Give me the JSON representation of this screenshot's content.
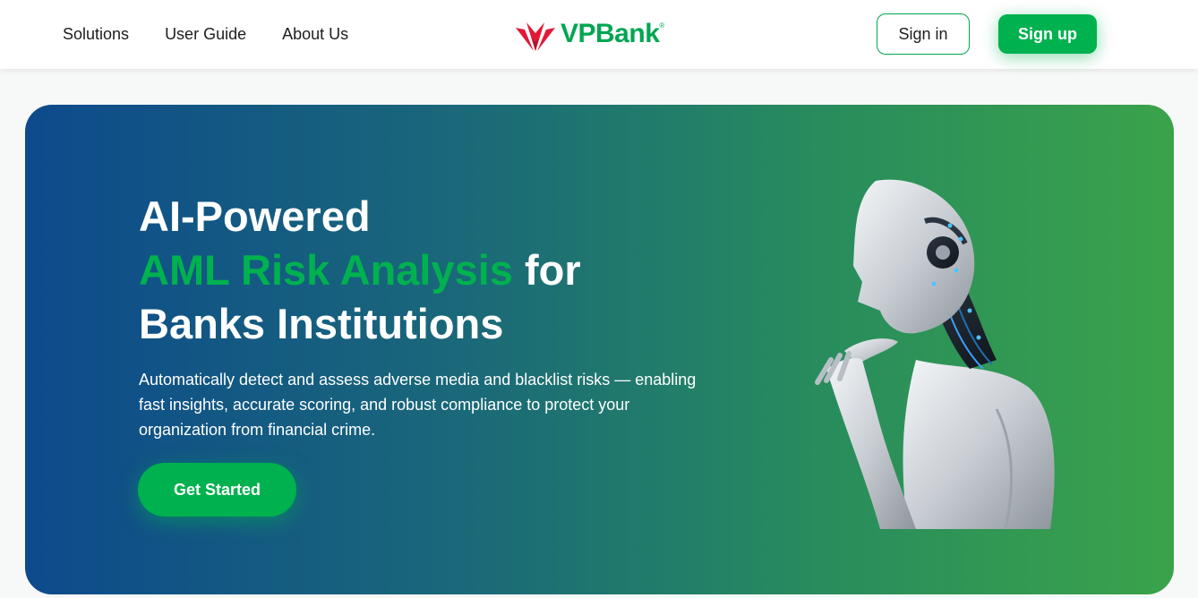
{
  "nav": {
    "items": [
      {
        "label": "Solutions"
      },
      {
        "label": "User Guide"
      },
      {
        "label": "About Us"
      }
    ]
  },
  "brand": {
    "name": "VPBank",
    "reg_mark": "®",
    "red": "#e31837",
    "green": "#00a651"
  },
  "auth": {
    "signin_label": "Sign in",
    "signup_label": "Sign up"
  },
  "hero": {
    "line1": "AI-Powered",
    "line2_accent": "AML Risk Analysis",
    "line2_rest": " for",
    "line3": "Banks Institutions",
    "description": "Automatically detect and assess adverse media and blacklist risks — enabling fast insights, accurate scoring, and robust compliance to protect your organization from financial crime.",
    "cta_label": "Get Started",
    "accent_color": "#00b14f"
  }
}
